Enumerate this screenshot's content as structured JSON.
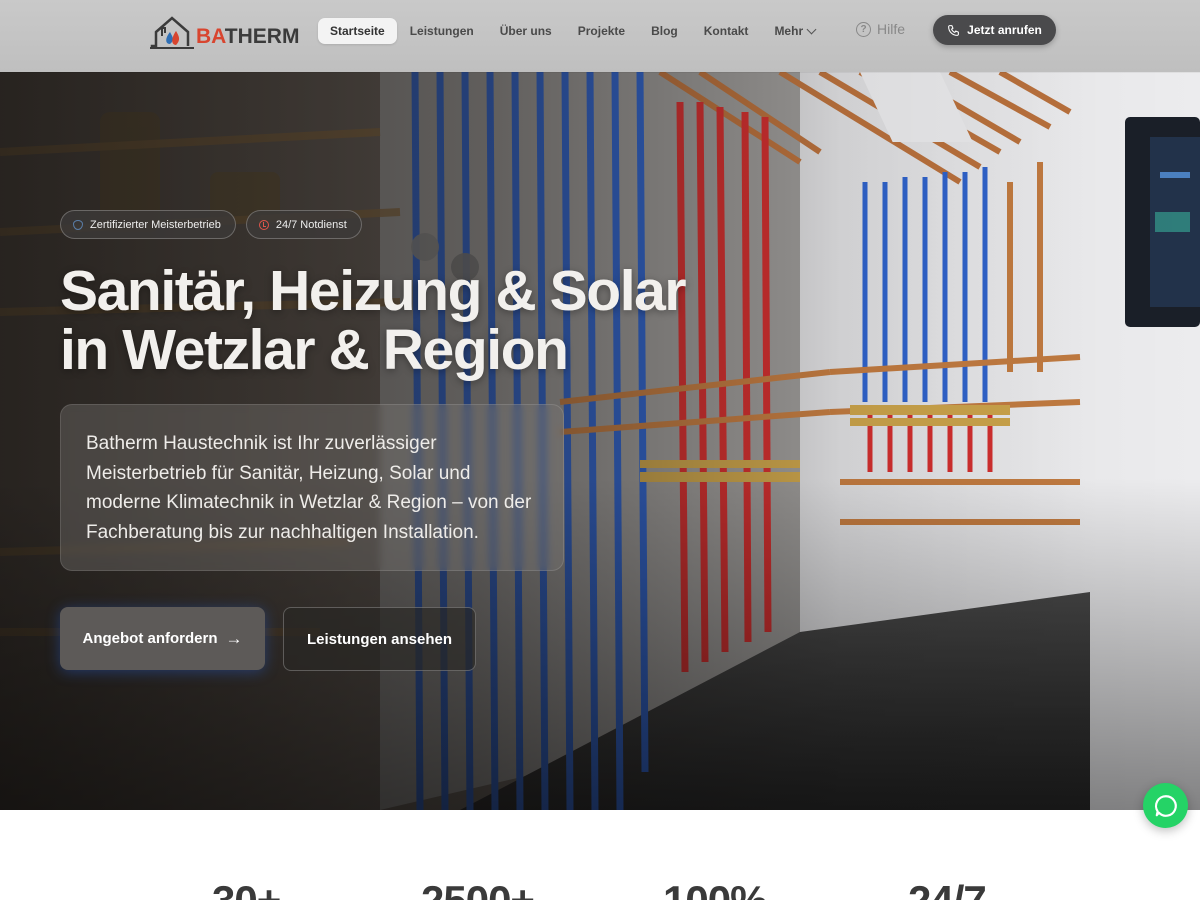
{
  "header": {
    "logo": {
      "ba": "BA",
      "therm": "THERM"
    },
    "nav": [
      {
        "label": "Startseite",
        "active": true
      },
      {
        "label": "Leistungen",
        "active": false
      },
      {
        "label": "Über uns",
        "active": false
      },
      {
        "label": "Projekte",
        "active": false
      },
      {
        "label": "Blog",
        "active": false
      },
      {
        "label": "Kontakt",
        "active": false
      }
    ],
    "more_label": "Mehr",
    "help_label": "Hilfe",
    "call_label": "Jetzt anrufen"
  },
  "hero": {
    "badges": [
      {
        "label": "Zertifizierter Meisterbetrieb",
        "icon": "shield-icon"
      },
      {
        "label": "24/7 Notdienst",
        "icon": "clock-icon"
      }
    ],
    "title_line1": "Sanitär, Heizung & Solar",
    "title_line2": "in Wetzlar & Region",
    "description": "Batherm Haustechnik ist Ihr zuverlässiger Meisterbetrieb für Sanitär, Heizung, Solar und moderne Klimatechnik in Wetzlar & Region – von der Fachberatung bis zur nachhaltigen Installation.",
    "primary_cta": "Angebot anfordern",
    "secondary_cta": "Leistungen ansehen"
  },
  "stats": [
    "30+",
    "2500+",
    "100%",
    "24/7"
  ],
  "colors": {
    "brand_red": "#d8452f",
    "whatsapp": "#25d366",
    "call_button": "#4a4a4c"
  }
}
